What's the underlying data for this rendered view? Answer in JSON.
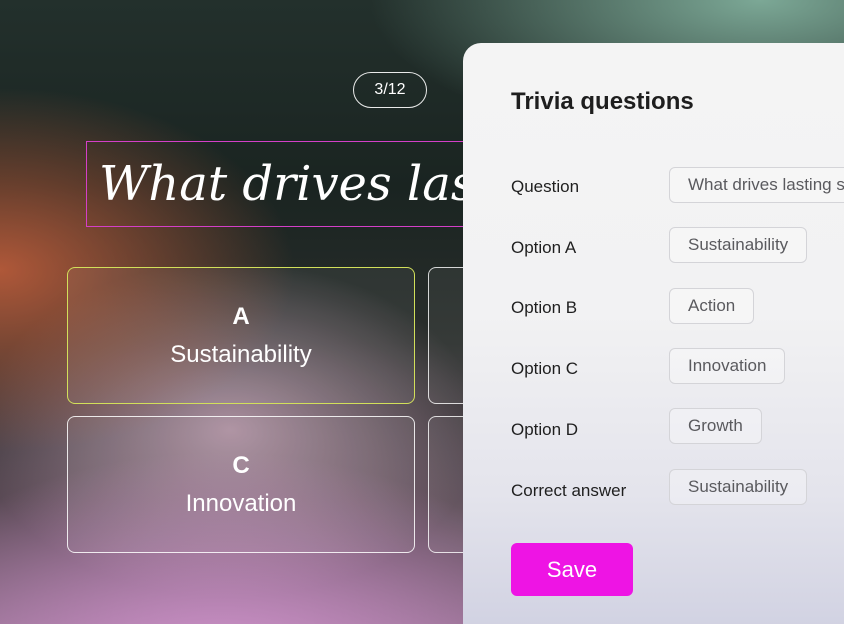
{
  "game": {
    "counter": "3/12",
    "question": "What drives lasting success?",
    "answers": [
      {
        "letter": "A",
        "label": "Sustainability"
      },
      {
        "letter": "C",
        "label": "Innovation"
      }
    ]
  },
  "panel": {
    "title": "Trivia questions",
    "fields": {
      "question": {
        "label": "Question",
        "value": "What drives lasting success?"
      },
      "option_a": {
        "label": "Option A",
        "value": "Sustainability"
      },
      "option_b": {
        "label": "Option B",
        "value": "Action"
      },
      "option_c": {
        "label": "Option C",
        "value": "Innovation"
      },
      "option_d": {
        "label": "Option D",
        "value": "Growth"
      },
      "correct": {
        "label": "Correct answer",
        "value": "Sustainability"
      }
    },
    "save_label": "Save"
  },
  "colors": {
    "save_button": "#ee14e4",
    "question_border": "#d43fc8",
    "selected_card_border": "#d2e05a"
  }
}
